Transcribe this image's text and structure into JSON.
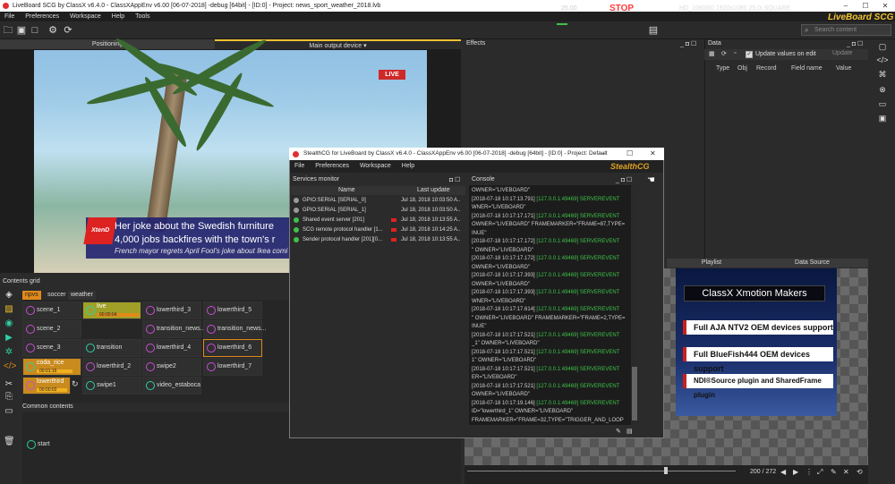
{
  "app": {
    "title": "LiveBoard SCG by ClassX v6.4.0 - ClassXAppEnv v6.00 [06-07-2018] -debug [64bit] - [ID:0] - Project: news_sport_weather_2018.lvb",
    "brand": "LiveBoard SCG",
    "menu": [
      "File",
      "Preferences",
      "Workspace",
      "Help",
      "Tools"
    ],
    "window_buttons": [
      "–",
      "☐",
      "✕"
    ]
  },
  "toolbar": {
    "time": "25.00",
    "stop": "STOP",
    "format": "HD_1080i50 1920x1080 25.0i SQUARE",
    "search_placeholder": "Search content"
  },
  "preview": {
    "tab_positioning": "Positioning",
    "tab_main_output": "Main output device ▾",
    "live_badge": "LIVE",
    "lower_third_line1": "Her joke about the Swedish furniture",
    "lower_third_line2": "4,000 jobs backfires with the town's r",
    "lower_third_line3": "French mayor regrets April Fool's joke about Ikea comi",
    "logo": "XtenD"
  },
  "contents_grid": {
    "label": "Contents grid",
    "tabs": [
      "npvs",
      "soccer",
      "weather"
    ],
    "cells": {
      "r1": [
        "scene_1",
        "live",
        "",
        "lowerthird_3",
        "lowerthird_5"
      ],
      "live_timer": "00:00:04",
      "r2": [
        "scene_2",
        "",
        "",
        "transition_news...",
        "transition_news..."
      ],
      "r3": [
        "scene_3",
        "transition",
        "",
        "lowerthird_4",
        "lowerthird_6"
      ],
      "r4": [
        "coda_rice",
        "lowerthird_2",
        "swipe2",
        "",
        "lowerthird_7"
      ],
      "coda_timer": "00:01:16",
      "r5": [
        "lowerthird",
        "swipe1",
        "video_estaboca",
        "",
        ""
      ],
      "lowerthird_timer": "00:00:02"
    }
  },
  "common_contents": {
    "label": "Common contents",
    "items": [
      "start"
    ]
  },
  "effects": {
    "label": "Effects"
  },
  "data_panel": {
    "label": "Data",
    "update_values_label": "Update values on edit",
    "update_button": "Update",
    "columns": [
      "Type",
      "Obj",
      "Record",
      "Field name",
      "Value"
    ]
  },
  "lower_panel": {
    "tabs": [
      "Playlist",
      "Data Source"
    ],
    "counter": "200 / 272"
  },
  "promo": {
    "title": "ClassX Xmotion Makers",
    "lines": [
      "Full AJA NTV2 OEM devices support",
      "Full BlueFish444 OEM devices support",
      "NDI®Source plugin and SharedFrame plugin"
    ]
  },
  "modal": {
    "title": "StealthCG for LiveBoard by ClassX v6.4.0 - ClassXAppEnv v6.00 [06-07-2018] -debug [64bit] - [ID:0] - Project: Default",
    "brand": "StealthCG",
    "menu": [
      "File",
      "Preferences",
      "Workspace",
      "Help"
    ],
    "services_label": "Services monitor",
    "services_header": {
      "name": "Name",
      "last_update": "Last update"
    },
    "services": [
      {
        "name": "GPIO:SERIAL [SERIAL_0]",
        "date": "Jul 18, 2018 10:03:50 A..",
        "color": "#9a9a9a"
      },
      {
        "name": "GPIO:SERIAL [SERIAL_1]",
        "date": "Jul 18, 2018 10:03:50 A..",
        "color": "#9a9a9a"
      },
      {
        "name": "Shared event server [201]",
        "date": "Jul 18, 2018 10:13:55 A..",
        "color": "#3fc24a"
      },
      {
        "name": "SCG remote protocol handler [1...",
        "date": "Jul 18, 2018 10:14:25 A..",
        "color": "#3fc24a"
      },
      {
        "name": "Sender protocol handler [201][0...",
        "date": "Jul 18, 2018 10:13:55 A..",
        "color": "#3fc24a"
      }
    ],
    "console_label": "Console",
    "console_lines": [
      {
        "w": "OWNER=\"LIVEBOARD\"",
        "g": ""
      },
      {
        "w": "[2018-07-18 10:17:13.791]",
        "g": " [127.0.0.1:49469] SERVEREVENT"
      },
      {
        "w": "WNER=\"LIVEBOARD\"",
        "g": ""
      },
      {
        "w": "[2018-07-18 10:17:17.171]",
        "g": " [127.0.0.1:49469] SERVEREVENT"
      },
      {
        "w": "OWNER=\"LIVEBOARD\" FRAMEMARKER=\"FRAME=87,TYPE=",
        "g": ""
      },
      {
        "w": "INUE\"",
        "g": ""
      },
      {
        "w": "[2018-07-18 10:17:17.172]",
        "g": " [127.0.0.1:49469] SERVEREVENT"
      },
      {
        "w": "\" OWNER=\"LIVEBOARD\"",
        "g": ""
      },
      {
        "w": "[2018-07-18 10:17:17.172]",
        "g": " [127.0.0.1:49469] SERVEREVENT"
      },
      {
        "w": "OWNER=\"LIVEBOARD\"",
        "g": ""
      },
      {
        "w": "[2018-07-18 10:17:17.393]",
        "g": " [127.0.0.1:49469] SERVEREVENT"
      },
      {
        "w": "OWNER=\"LIVEBOARD\"",
        "g": ""
      },
      {
        "w": "[2018-07-18 10:17:17.393]",
        "g": " [127.0.0.1:49469] SERVEREVENT"
      },
      {
        "w": "WNER=\"LIVEBOARD\"",
        "g": ""
      },
      {
        "w": "[2018-07-18 10:17:17.614]",
        "g": " [127.0.0.1:49469] SERVEREVENT"
      },
      {
        "w": "\" OWNER=\"LIVEBOARD\" FRAMEMARKER=\"FRAME=2,TYPE=",
        "g": ""
      },
      {
        "w": "INUE\"",
        "g": ""
      },
      {
        "w": "[2018-07-18 10:17:17.521]",
        "g": " [127.0.0.1:49469] SERVEREVENT"
      },
      {
        "w": "_1\" OWNER=\"LIVEBOARD\"",
        "g": ""
      },
      {
        "w": "[2018-07-18 10:17:17.521]",
        "g": " [127.0.0.1:49469] SERVEREVENT"
      },
      {
        "w": "1\" OWNER=\"LIVEBOARD\"",
        "g": ""
      },
      {
        "w": "[2018-07-18 10:17:17.521]",
        "g": " [127.0.0.1:49469] SERVEREVENT"
      },
      {
        "w": "ER=\"LIVEBOARD\"",
        "g": ""
      },
      {
        "w": "[2018-07-18 10:17:17.521]",
        "g": " [127.0.0.1:49469] SERVEREVENT"
      },
      {
        "w": "OWNER=\"LIVEBOARD\"",
        "g": ""
      },
      {
        "w": "[2018-07-18 10:17:19.146]",
        "g": " [127.0.0.1:49469] SERVEREVENT"
      },
      {
        "w": "ID=\"lowerthird_1\" OWNER=\"LIVEBOARD\"",
        "g": ""
      },
      {
        "w": "FRAMEMARKER=\"FRAME=32,TYPE=\"TRIGGER_AND_LOOP",
        "g": ""
      }
    ]
  },
  "colors": {
    "accent": "#f2c230",
    "stop": "#ff3a3a",
    "console_green": "#3fc24a",
    "pink_icon": "#c84ed6",
    "teal_icon": "#2fd0a3"
  }
}
